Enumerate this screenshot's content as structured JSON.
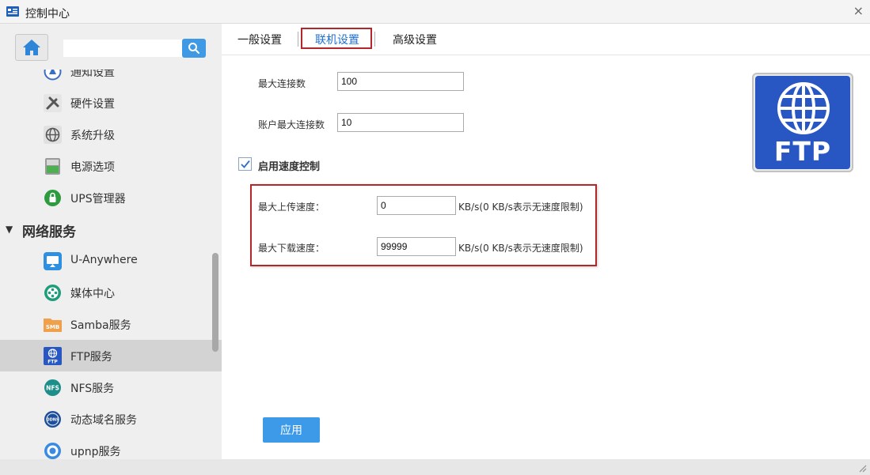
{
  "window": {
    "title": "控制中心",
    "close_glyph": "×"
  },
  "search": {
    "placeholder": "",
    "value": ""
  },
  "sidebar": {
    "items": [
      {
        "label": "通知设置",
        "icon": "notification-icon"
      },
      {
        "label": "硬件设置",
        "icon": "hardware-icon"
      },
      {
        "label": "系统升级",
        "icon": "system-upgrade-icon"
      },
      {
        "label": "电源选项",
        "icon": "power-icon"
      },
      {
        "label": "UPS管理器",
        "icon": "ups-icon"
      }
    ],
    "section": {
      "label": "网络服务",
      "expanded": true
    },
    "section_items": [
      {
        "label": "U-Anywhere",
        "icon": "u-anywhere-icon"
      },
      {
        "label": "媒体中心",
        "icon": "media-center-icon"
      },
      {
        "label": "Samba服务",
        "icon": "samba-icon",
        "icon_text": "SMB"
      },
      {
        "label": "FTP服务",
        "icon": "ftp-icon",
        "icon_text": "FTP",
        "active": true
      },
      {
        "label": "NFS服务",
        "icon": "nfs-icon",
        "icon_text": "NFS"
      },
      {
        "label": "动态域名服务",
        "icon": "ddns-icon",
        "icon_text": "DDNS"
      },
      {
        "label": "upnp服务",
        "icon": "upnp-icon"
      }
    ]
  },
  "tabs": [
    {
      "label": "一般设置",
      "active": false
    },
    {
      "label": "联机设置",
      "active": true
    },
    {
      "label": "高级设置",
      "active": false
    }
  ],
  "form": {
    "max_connections": {
      "label": "最大连接数",
      "value": "100"
    },
    "max_account_connections": {
      "label": "账户最大连接数",
      "value": "10"
    },
    "speed_control": {
      "label": "启用速度控制",
      "checked": true
    },
    "max_upload": {
      "label": "最大上传速度：",
      "value": "0",
      "hint": "KB/s(0 KB/s表示无速度限制)"
    },
    "max_download": {
      "label": "最大下载速度：",
      "value": "99999",
      "hint": "KB/s(0 KB/s表示无速度限制)"
    }
  },
  "logo": {
    "text": "FTP"
  },
  "apply_label": "应用",
  "colors": {
    "accent": "#3d9ae9",
    "highlight_border": "#b3262a",
    "active_tab": "#1f6fd0",
    "ftp_blue": "#2856c3"
  }
}
